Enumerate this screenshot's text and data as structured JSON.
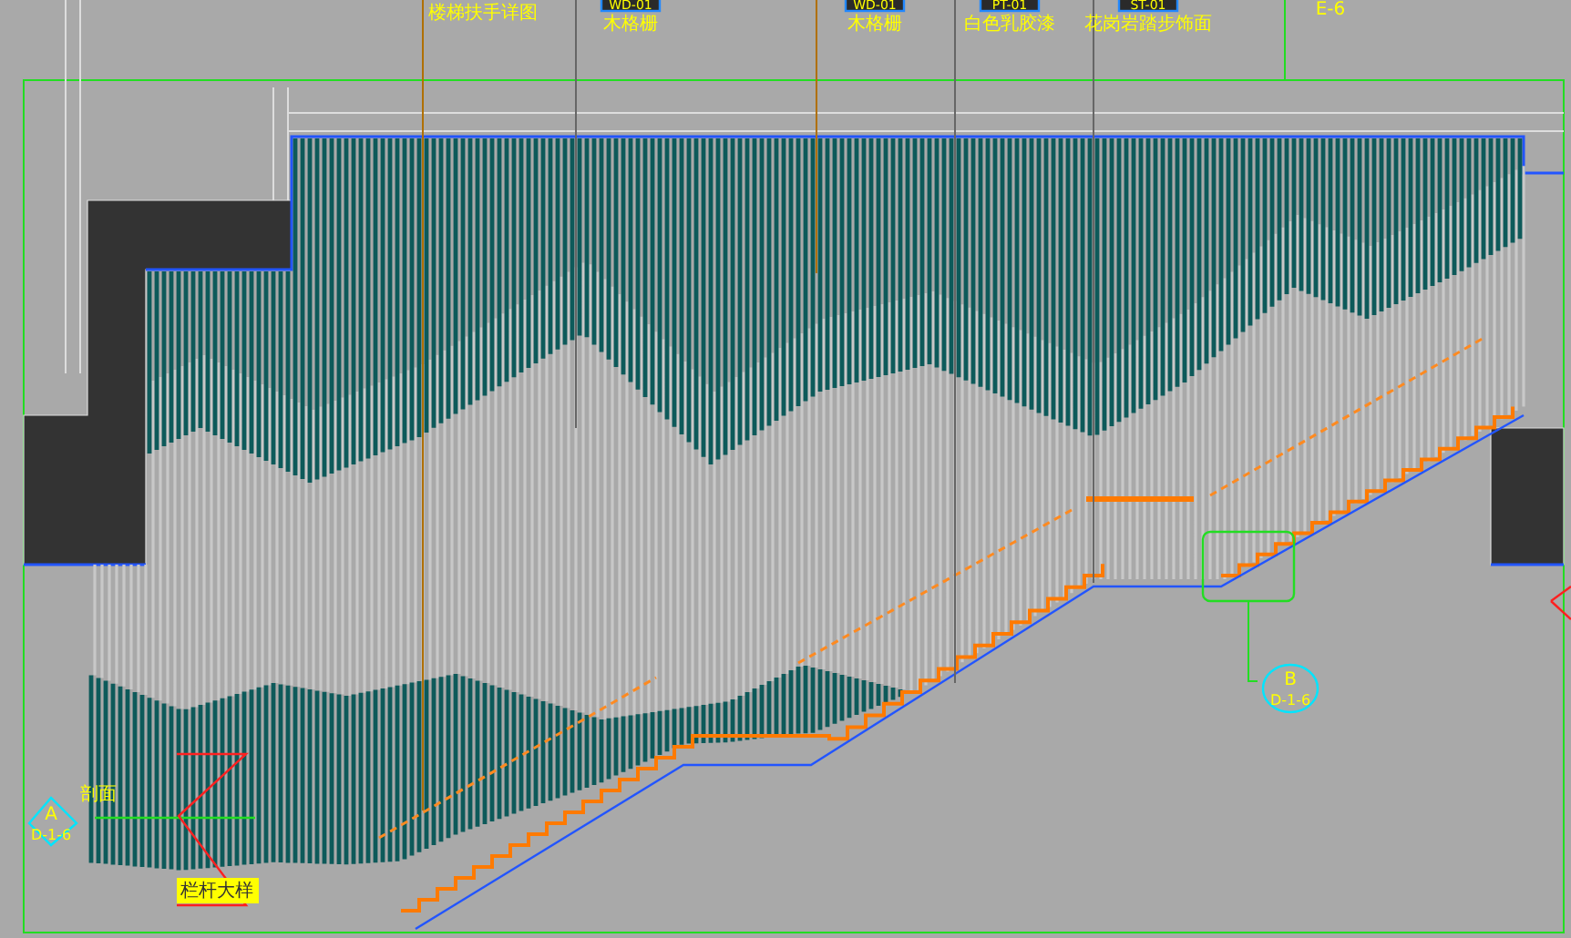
{
  "top_labels": [
    {
      "text": "楼梯扶手详图"
    },
    {
      "tag": "WD-01",
      "text": "木格栅"
    },
    {
      "tag": "WD-01",
      "text": "木格栅"
    },
    {
      "tag": "PT-01",
      "text": "白色乳胶漆"
    },
    {
      "tag": "ST-01",
      "text": "花岗岩踏步饰面"
    }
  ],
  "section_marks": [
    {
      "kind": "callout",
      "code": "E-6"
    },
    {
      "kind": "section",
      "letter": "A",
      "code": "D-1-6",
      "caption": "剖面"
    },
    {
      "kind": "section",
      "letter": "B",
      "code": "D-1-6"
    }
  ],
  "detail_tag": {
    "text": "栏杆大样"
  }
}
